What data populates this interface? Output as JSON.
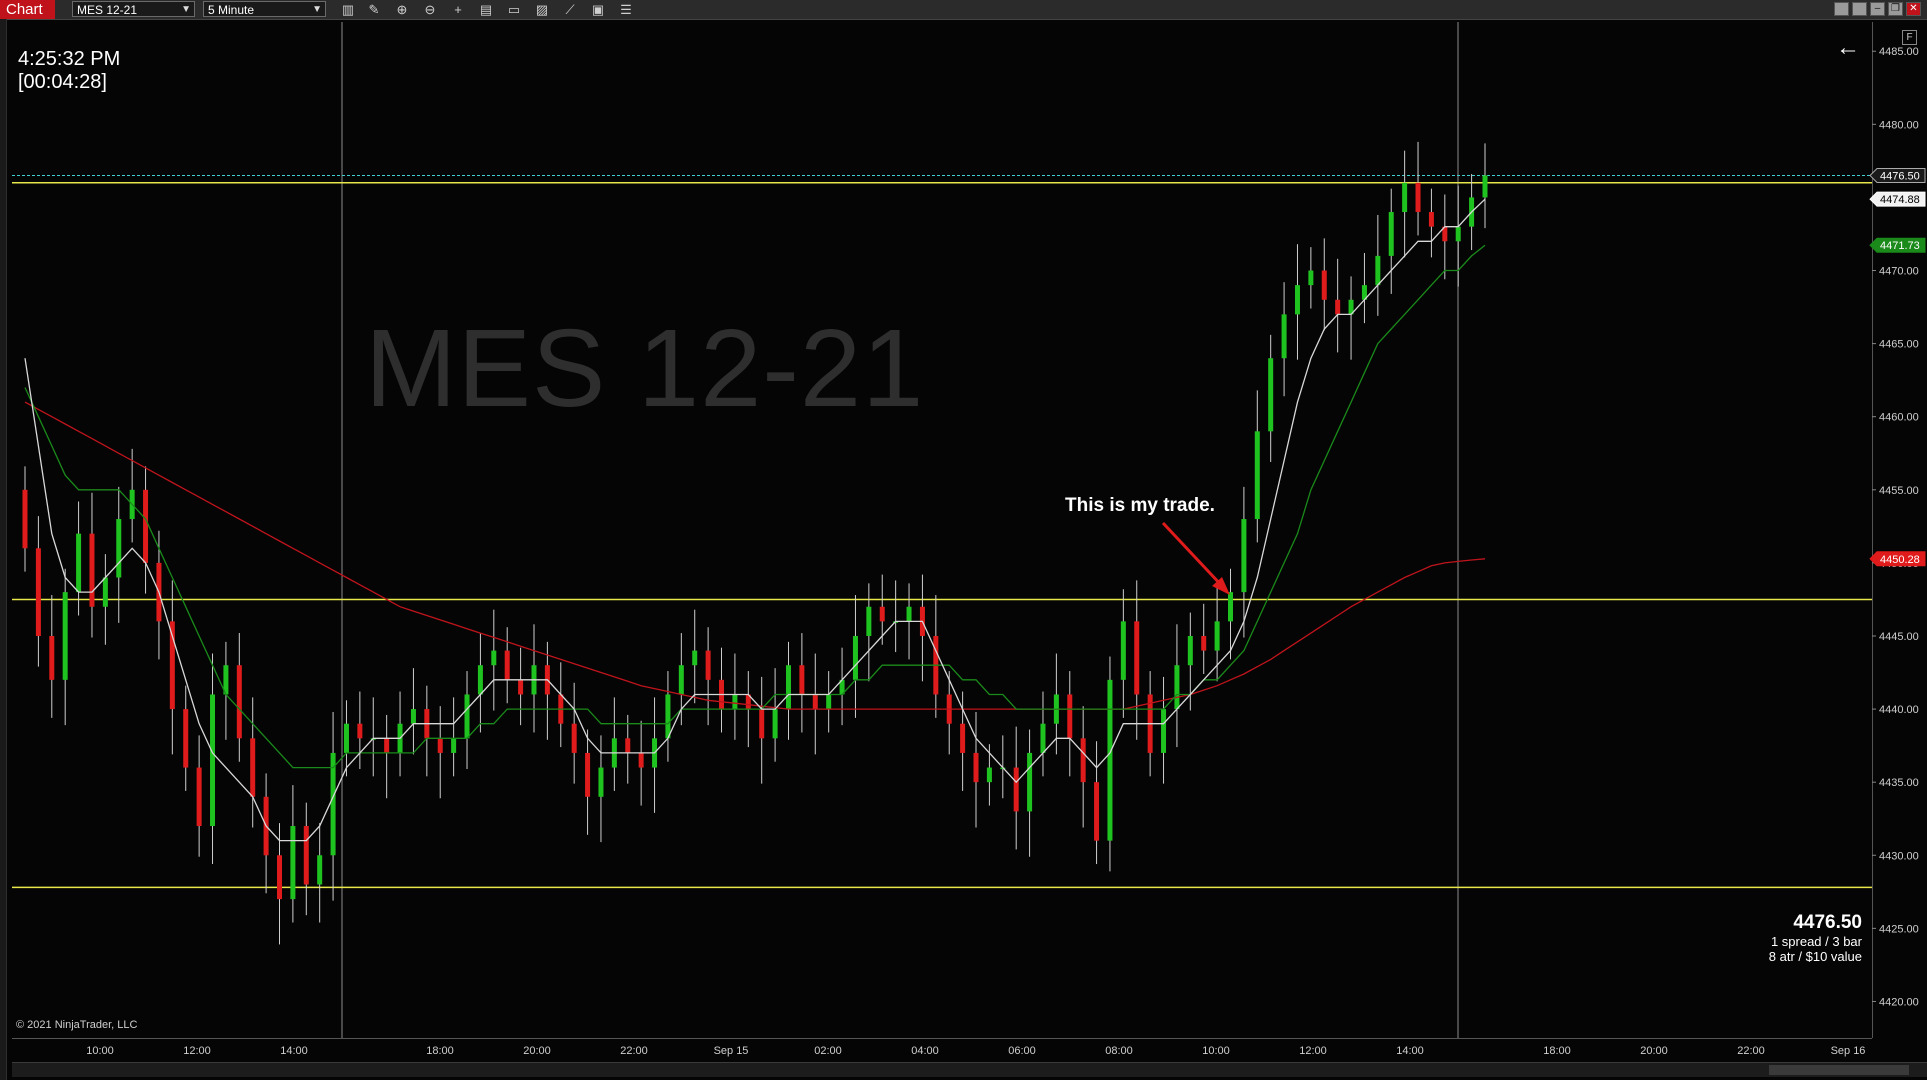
{
  "toolbar": {
    "tab_label": "Chart",
    "instrument": "MES 12-21",
    "timeframe": "5 Minute",
    "icons": [
      "bars-icon",
      "pencil-icon",
      "zoom-in-icon",
      "zoom-out-icon",
      "crosshair-icon",
      "data-box-icon",
      "templates-icon",
      "indicators-icon",
      "strategies-icon",
      "properties-icon",
      "list-icon"
    ]
  },
  "chart": {
    "watermark": "MES 12-21",
    "clock": "4:25:32 PM",
    "countdown": "[00:04:28]",
    "annotation": "This is my trade.",
    "info": {
      "price": "4476.50",
      "line1": "1 spread / 3 bar",
      "line2": "8 atr / $10 value"
    },
    "copyright": "© 2021 NinjaTrader, LLC",
    "f_button": "F"
  },
  "chart_data": {
    "type": "line",
    "ylim": [
      4417.5,
      4487
    ],
    "price_ticks": [
      "4485.00",
      "4480.00",
      "4475.00",
      "4470.00",
      "4465.00",
      "4460.00",
      "4455.00",
      "4450.00",
      "4445.00",
      "4440.00",
      "4435.00",
      "4430.00",
      "4425.00",
      "4420.00"
    ],
    "price_tick_values": [
      4485,
      4480,
      4475,
      4470,
      4465,
      4460,
      4455,
      4450,
      4445,
      4440,
      4435,
      4430,
      4425,
      4420
    ],
    "time_ticks": [
      "10:00",
      "12:00",
      "14:00",
      "18:00",
      "20:00",
      "22:00",
      "Sep 15",
      "02:00",
      "04:00",
      "06:00",
      "08:00",
      "10:00",
      "12:00",
      "14:00",
      "18:00",
      "20:00",
      "22:00",
      "Sep 16"
    ],
    "price_markers": [
      {
        "label": "4476.50",
        "value": 4476.5,
        "style": "last"
      },
      {
        "label": "4474.88",
        "value": 4474.88,
        "style": "white"
      },
      {
        "label": "4471.73",
        "value": 4471.73,
        "style": "green"
      },
      {
        "label": "4450.28",
        "value": 4450.28,
        "style": "red"
      }
    ],
    "horizontal_lines": [
      4476.5,
      4476.0,
      4447.5,
      4427.8
    ],
    "close_series": [
      4451,
      4445,
      4442,
      4448,
      4452,
      4447,
      4449,
      4453,
      4455,
      4450,
      4446,
      4440,
      4436,
      4432,
      4441,
      4443,
      4438,
      4434,
      4430,
      4427,
      4432,
      4428,
      4430,
      4437,
      4439,
      4438,
      4438,
      4437,
      4439,
      4440,
      4438,
      4437,
      4438,
      4441,
      4443,
      4444,
      4442,
      4441,
      4443,
      4441,
      4439,
      4437,
      4434,
      4436,
      4438,
      4437,
      4436,
      4438,
      4441,
      4443,
      4444,
      4442,
      4440,
      4441,
      4440,
      4438,
      4440,
      4443,
      4441,
      4440,
      4441,
      4442,
      4445,
      4447,
      4446,
      4446,
      4447,
      4445,
      4441,
      4439,
      4437,
      4435,
      4436,
      4436,
      4433,
      4437,
      4439,
      4441,
      4438,
      4435,
      4431,
      4442,
      4446,
      4441,
      4437,
      4440,
      4443,
      4445,
      4444,
      4446,
      4448,
      4453,
      4459,
      4464,
      4467,
      4469,
      4470,
      4468,
      4467,
      4468,
      4469,
      4471,
      4474,
      4476,
      4474,
      4473,
      4472,
      4473,
      4475,
      4476.5
    ],
    "sma_white": [
      4464,
      4458,
      4452,
      4449,
      4448,
      4448,
      4449,
      4450,
      4451,
      4450,
      4448,
      4445,
      4442,
      4439,
      4437,
      4436,
      4435,
      4434,
      4432,
      4431,
      4431,
      4431,
      4432,
      4434,
      4436,
      4437,
      4438,
      4438,
      4438,
      4439,
      4439,
      4439,
      4439,
      4440,
      4441,
      4442,
      4442,
      4442,
      4442,
      4442,
      4441,
      4440,
      4438,
      4437,
      4437,
      4437,
      4437,
      4437,
      4438,
      4440,
      4441,
      4441,
      4441,
      4441,
      4441,
      4440,
      4440,
      4441,
      4441,
      4441,
      4441,
      4442,
      4443,
      4444,
      4445,
      4446,
      4446,
      4446,
      4444,
      4442,
      4440,
      4438,
      4437,
      4436,
      4435,
      4436,
      4437,
      4438,
      4438,
      4437,
      4436,
      4437,
      4439,
      4439,
      4439,
      4439,
      4440,
      4441,
      4442,
      4443,
      4444,
      4446,
      4449,
      4453,
      4457,
      4461,
      4464,
      4466,
      4467,
      4467,
      4468,
      4469,
      4470,
      4471,
      4472,
      4472,
      4473,
      4473,
      4474,
      4474.88
    ],
    "sma_green": [
      4462,
      4460,
      4458,
      4456,
      4455,
      4455,
      4455,
      4455,
      4454,
      4453,
      4451,
      4449,
      4447,
      4445,
      4443,
      4441,
      4440,
      4439,
      4438,
      4437,
      4436,
      4436,
      4436,
      4436,
      4437,
      4437,
      4437,
      4437,
      4437,
      4437,
      4438,
      4438,
      4438,
      4438,
      4439,
      4439,
      4440,
      4440,
      4440,
      4440,
      4440,
      4440,
      4440,
      4439,
      4439,
      4439,
      4439,
      4439,
      4439,
      4440,
      4440,
      4440,
      4440,
      4440,
      4440,
      4440,
      4441,
      4441,
      4441,
      4441,
      4441,
      4441,
      4442,
      4442,
      4443,
      4443,
      4443,
      4443,
      4443,
      4443,
      4442,
      4442,
      4441,
      4441,
      4440,
      4440,
      4440,
      4440,
      4440,
      4440,
      4440,
      4440,
      4440,
      4440,
      4440,
      4440,
      4441,
      4441,
      4442,
      4442,
      4443,
      4444,
      4446,
      4448,
      4450,
      4452,
      4455,
      4457,
      4459,
      4461,
      4463,
      4465,
      4466,
      4467,
      4468,
      4469,
      4470,
      4470,
      4471,
      4471.73
    ],
    "sma_red": [
      4461,
      4460.5,
      4460,
      4459.5,
      4459,
      4458.5,
      4458,
      4457.5,
      4457,
      4456.5,
      4456,
      4455.5,
      4455,
      4454.5,
      4454,
      4453.5,
      4453,
      4452.5,
      4452,
      4451.5,
      4451,
      4450.5,
      4450,
      4449.5,
      4449,
      4448.5,
      4448,
      4447.5,
      4447,
      4446.7,
      4446.4,
      4446.1,
      4445.8,
      4445.5,
      4445.2,
      4444.9,
      4444.6,
      4444.3,
      4444,
      4443.7,
      4443.4,
      4443.1,
      4442.8,
      4442.5,
      4442.2,
      4441.9,
      4441.6,
      4441.4,
      4441.2,
      4441,
      4440.8,
      4440.6,
      4440.5,
      4440.4,
      4440.3,
      4440.2,
      4440.1,
      4440,
      4440,
      4440,
      4440,
      4440,
      4440,
      4440,
      4440,
      4440,
      4440,
      4440,
      4440,
      4440,
      4440,
      4440,
      4440,
      4440,
      4440,
      4440,
      4440,
      4440,
      4440,
      4440,
      4440,
      4440,
      4440,
      4440.2,
      4440.4,
      4440.6,
      4440.8,
      4441,
      4441.3,
      4441.6,
      4442,
      4442.4,
      4442.9,
      4443.4,
      4444,
      4444.6,
      4445.2,
      4445.8,
      4446.4,
      4447,
      4447.5,
      4448,
      4448.5,
      4449,
      4449.4,
      4449.8,
      4450,
      4450.1,
      4450.2,
      4450.28
    ]
  }
}
